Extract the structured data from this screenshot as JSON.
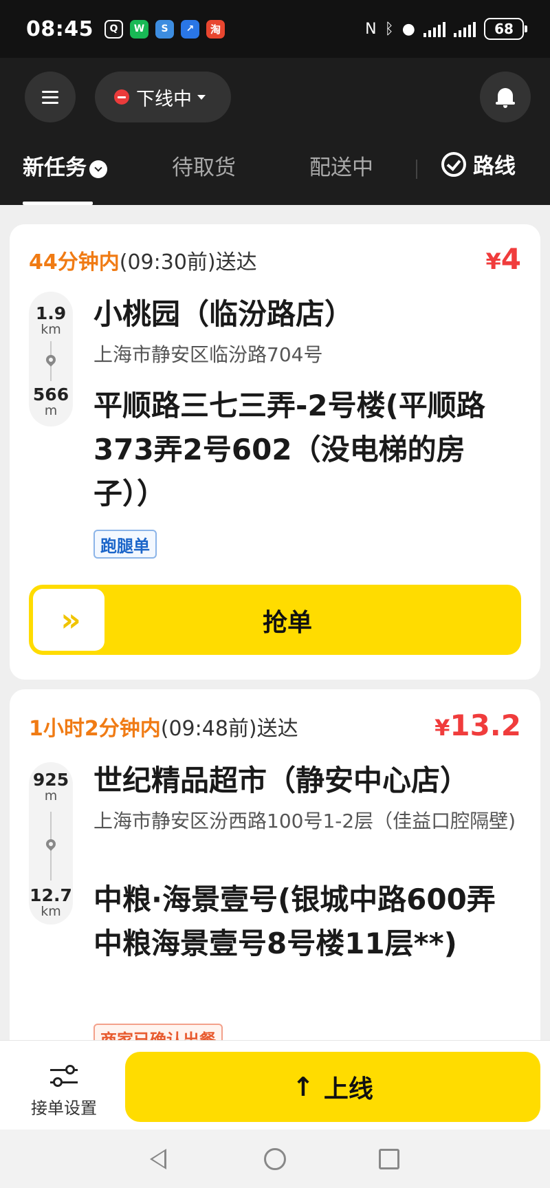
{
  "status_bar": {
    "time": "08:45",
    "battery": "68",
    "notification_icons": [
      {
        "name": "qq-icon",
        "glyph": "Q",
        "color": "#1a1a1a"
      },
      {
        "name": "wechat-icon",
        "glyph": "W",
        "color": "#19b955"
      },
      {
        "name": "browser-icon",
        "glyph": "S",
        "color": "#3d8de0"
      },
      {
        "name": "tool-icon",
        "glyph": "↗",
        "color": "#2a76e6"
      },
      {
        "name": "taobao-icon",
        "glyph": "淘",
        "color": "#e8462f"
      }
    ]
  },
  "header": {
    "status": "下线中"
  },
  "tabs": {
    "new": "新任务",
    "pickup": "待取货",
    "delivering": "配送中",
    "route": "路线"
  },
  "orders": [
    {
      "deadline_highlight": "44分钟内",
      "deadline_rest": "(09:30前)送达",
      "price_symbol": "¥",
      "price": "4",
      "pickup_distance": "1.9",
      "pickup_unit": "km",
      "drop_distance": "566",
      "drop_unit": "m",
      "shop": "小桃园（临汾路店）",
      "shop_address": "上海市静安区临汾路704号",
      "destination": "平顺路三七三弄-2号楼(平顺路373弄2号602（没电梯的房子））",
      "tag": "跑腿单",
      "grab_label": "抢单",
      "grab_knob": "»"
    },
    {
      "deadline_highlight": "1小时2分钟内",
      "deadline_rest": "(09:48前)送达",
      "price_symbol": "¥",
      "price": "13.2",
      "pickup_distance": "925",
      "pickup_unit": "m",
      "drop_distance": "12.7",
      "drop_unit": "km",
      "shop": "世纪精品超市（静安中心店）",
      "shop_address": "上海市静安区汾西路100号1-2层（佳益口腔隔壁)",
      "destination": "中粮·海景壹号(银城中路600弄中粮海景壹号8号楼11层**)",
      "tag": "商家已确认出餐"
    }
  ],
  "bottom": {
    "settings_label": "接单设置",
    "online_label": "上线",
    "online_arrow": "↑"
  },
  "colors": {
    "accent_yellow": "#ffdc00",
    "deadline_orange": "#f07b14",
    "price_red": "#f03c3c",
    "dark_header": "#1d1d1d"
  }
}
